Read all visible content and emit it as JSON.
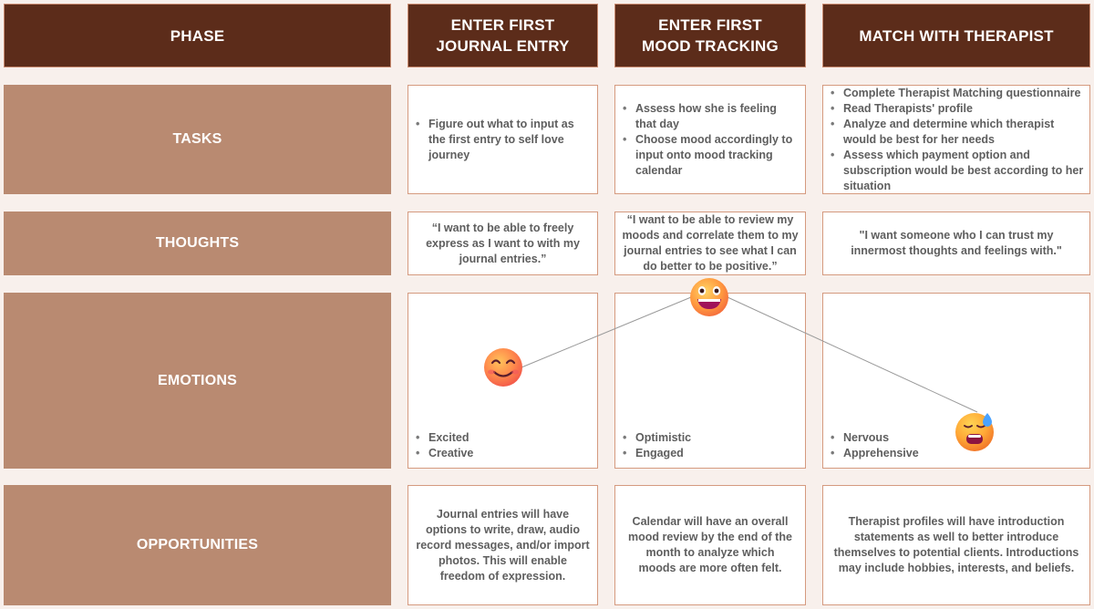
{
  "headers": {
    "phase": "PHASE",
    "col1": [
      "ENTER FIRST",
      "JOURNAL ENTRY"
    ],
    "col2": [
      "ENTER FIRST",
      "MOOD TRACKING"
    ],
    "col3": "MATCH WITH THERAPIST"
  },
  "rows": {
    "tasks": "TASKS",
    "thoughts": "THOUGHTS",
    "emotions": "EMOTIONS",
    "opportunities": "OPPORTUNITIES"
  },
  "tasks": {
    "col1": [
      "Figure out what to input as the first entry to self love journey"
    ],
    "col2": [
      "Assess how she is feeling that day",
      "Choose mood accordingly to input onto mood tracking calendar"
    ],
    "col3": [
      "Complete Therapist Matching questionnaire",
      "Read Therapists' profile",
      "Analyze and determine which therapist would be best for her needs",
      "Assess which payment option and subscription would be best according to her situation"
    ]
  },
  "thoughts": {
    "col1": "“I want to be able to freely express as I want to with my journal entries.”",
    "col2": "“I want to be able to review my moods and correlate them to my journal entries to see what I can do better to be positive.”",
    "col3": "\"I want someone who I can trust my innermost thoughts and feelings with.\""
  },
  "emotions": {
    "col1": [
      "Excited",
      "Creative"
    ],
    "col2": [
      "Optimistic",
      "Engaged"
    ],
    "col3": [
      "Nervous",
      "Apprehensive"
    ],
    "icons": [
      "smiling-face-icon",
      "grinning-face-icon",
      "anxious-sweat-face-icon"
    ]
  },
  "opportunities": {
    "col1": "Journal entries will have options to write, draw, audio record messages, and/or import photos. This will enable freedom of expression.",
    "col2": "Calendar will have an overall mood review by the end of the month to analyze which moods are more often felt.",
    "col3": "Therapist profiles will have introduction statements as well to better introduce themselves to potential clients. Introductions may include hobbies, interests, and beliefs."
  },
  "colors": {
    "header_bg": "#5c2c1a",
    "row_label_bg": "#b98a71",
    "box_border": "#d59a7f",
    "page_bg": "#f8f0ec",
    "text": "#5e5e5e"
  }
}
